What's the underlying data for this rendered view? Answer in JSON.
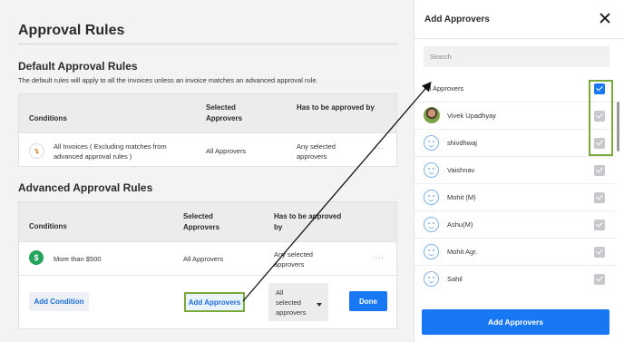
{
  "page": {
    "title": "Approval Rules",
    "default_section": {
      "title": "Default Approval Rules",
      "description": "The default rules will apply to all the invoices unless an invoice matches an advanced approval rule.",
      "headers": [
        "Conditions",
        "Selected Approvers",
        "Has to be approved by"
      ],
      "row": {
        "condition": "All Invoices ( Excluding matches from advanced approval rules )",
        "approvers": "All Approvers",
        "approved_by": "Any selected approvers",
        "menu": "···"
      }
    },
    "advanced_section": {
      "title": "Advanced Approval Rules",
      "headers": [
        "Conditions",
        "Selected Approvers",
        "Has to be approved by"
      ],
      "row": {
        "condition": "More than $500",
        "approvers": "All Approvers",
        "approved_by": "Any selected approvers",
        "menu": "···"
      },
      "add_condition_label": "Add Condition",
      "add_approvers_label": "Add Approvers",
      "select_value": "All selected approvers",
      "done_label": "Done"
    }
  },
  "drawer": {
    "title": "Add Approvers",
    "search_placeholder": "Search",
    "approvers": [
      {
        "name": "All Approvers",
        "checked": true,
        "avatar": "none"
      },
      {
        "name": "Vivek Upadhyay",
        "checked": true,
        "avatar": "photo"
      },
      {
        "name": "shivdhwaj",
        "checked": true,
        "avatar": "face-icon"
      },
      {
        "name": "Vaishnav",
        "checked": true,
        "avatar": "face-icon"
      },
      {
        "name": "Mohit (M)",
        "checked": true,
        "avatar": "face-icon"
      },
      {
        "name": "Ashu(M)",
        "checked": true,
        "avatar": "face-icon"
      },
      {
        "name": "Mohit Agr.",
        "checked": true,
        "avatar": "face-icon"
      },
      {
        "name": "Sahil",
        "checked": true,
        "avatar": "face-icon"
      }
    ],
    "submit_label": "Add Approvers"
  },
  "colors": {
    "primary": "#1877f2",
    "highlight": "#7aa83b",
    "success": "#24a35a"
  }
}
